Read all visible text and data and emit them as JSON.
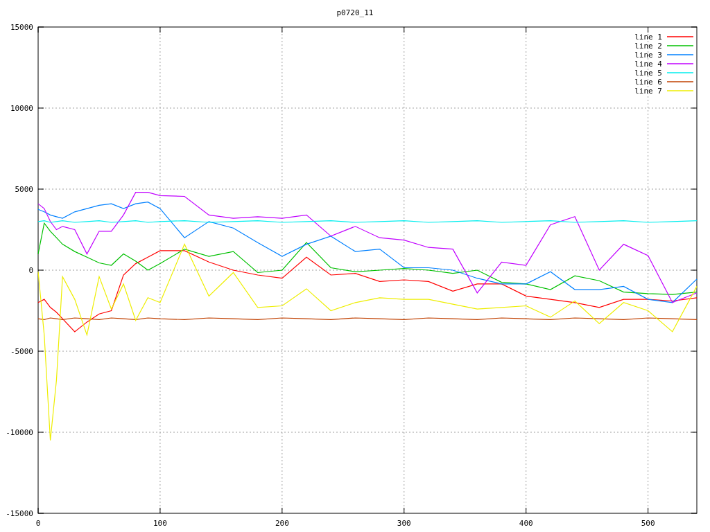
{
  "chart": {
    "chart_data": {
      "type": "line",
      "title": "p0720_11",
      "x": [
        0,
        5,
        10,
        15,
        20,
        30,
        40,
        50,
        60,
        70,
        80,
        90,
        100,
        120,
        140,
        160,
        180,
        200,
        220,
        240,
        260,
        280,
        300,
        320,
        340,
        360,
        380,
        400,
        420,
        440,
        460,
        480,
        500,
        520,
        540
      ],
      "series": [
        {
          "name": "line 1",
          "color": "#ff0000",
          "values": [
            -2000,
            -1800,
            -2300,
            -2600,
            -3000,
            -3800,
            -3200,
            -2700,
            -2500,
            -300,
            400,
            800,
            1200,
            1200,
            500,
            0,
            -300,
            -500,
            800,
            -300,
            -200,
            -700,
            -600,
            -700,
            -1300,
            -850,
            -850,
            -1600,
            -1800,
            -2000,
            -2300,
            -1800,
            -1800,
            -1900,
            -1700
          ]
        },
        {
          "name": "line 2",
          "color": "#00c000",
          "values": [
            1000,
            2900,
            2400,
            2000,
            1600,
            1150,
            800,
            450,
            300,
            1000,
            550,
            0,
            400,
            1300,
            850,
            1150,
            -150,
            0,
            1700,
            150,
            -100,
            0,
            100,
            0,
            -200,
            0,
            -750,
            -850,
            -1200,
            -350,
            -650,
            -1350,
            -1450,
            -1500,
            -1350
          ]
        },
        {
          "name": "line 3",
          "color": "#0080ff",
          "values": [
            3750,
            3600,
            3400,
            3300,
            3200,
            3600,
            3800,
            4000,
            4100,
            3800,
            4100,
            4200,
            3800,
            2000,
            3000,
            2600,
            1700,
            850,
            1600,
            2100,
            1150,
            1300,
            150,
            150,
            0,
            -500,
            -850,
            -850,
            -100,
            -1200,
            -1200,
            -1000,
            -1800,
            -2000,
            -550
          ]
        },
        {
          "name": "line 4",
          "color": "#c000ff",
          "values": [
            4100,
            3800,
            3000,
            2500,
            2700,
            2500,
            1000,
            2400,
            2400,
            3400,
            4800,
            4800,
            4600,
            4550,
            3400,
            3200,
            3300,
            3200,
            3400,
            2100,
            2700,
            2000,
            1850,
            1400,
            1300,
            -1400,
            500,
            300,
            2800,
            3300,
            0,
            1600,
            900,
            -2000,
            -1400
          ]
        },
        {
          "name": "line 5",
          "color": "#00eeee",
          "values": [
            3000,
            3050,
            2950,
            3000,
            3050,
            2950,
            3000,
            3050,
            2950,
            3000,
            3050,
            2950,
            3000,
            3050,
            2950,
            3000,
            3050,
            2950,
            3000,
            3050,
            2950,
            3000,
            3050,
            2950,
            3000,
            3050,
            2950,
            3000,
            3050,
            2950,
            3000,
            3050,
            2950,
            3000,
            3050
          ]
        },
        {
          "name": "line 6",
          "color": "#c04000",
          "values": [
            -3000,
            -3050,
            -2950,
            -3000,
            -3050,
            -2950,
            -3000,
            -3050,
            -2950,
            -3000,
            -3050,
            -2950,
            -3000,
            -3050,
            -2950,
            -3000,
            -3050,
            -2950,
            -3000,
            -3050,
            -2950,
            -3000,
            -3050,
            -2950,
            -3000,
            -3050,
            -2950,
            -3000,
            -3050,
            -2950,
            -3000,
            -3050,
            -2950,
            -3000,
            -3050
          ]
        },
        {
          "name": "line 7",
          "color": "#eeee00",
          "values": [
            -100,
            -4000,
            -10500,
            -6800,
            -400,
            -1800,
            -4000,
            -400,
            -2400,
            -850,
            -3100,
            -1700,
            -2000,
            1600,
            -1600,
            -150,
            -2300,
            -2200,
            -1150,
            -2500,
            -2000,
            -1700,
            -1800,
            -1800,
            -2100,
            -2400,
            -2300,
            -2200,
            -2900,
            -1900,
            -3300,
            -2000,
            -2500,
            -3800,
            -1000
          ]
        }
      ],
      "grid": true,
      "legend": "upper right",
      "xlim": [
        0,
        540
      ],
      "ylim": [
        -15000,
        15000
      ],
      "xticks": [
        0,
        100,
        200,
        300,
        400,
        500
      ],
      "yticks": [
        -15000,
        -10000,
        -5000,
        0,
        5000,
        10000,
        15000
      ]
    }
  }
}
